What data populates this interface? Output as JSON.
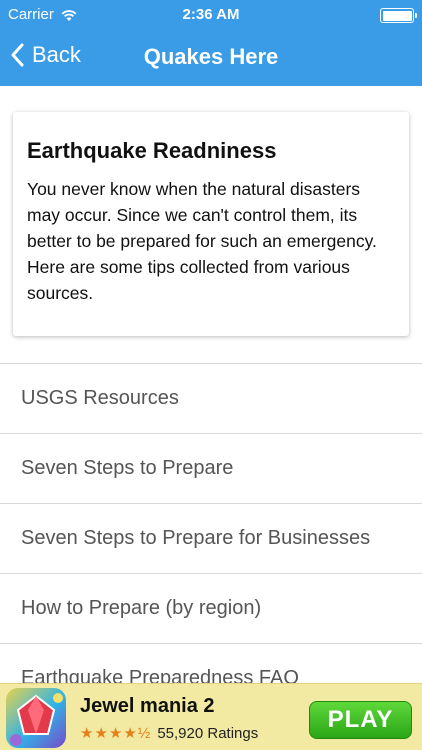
{
  "status_bar": {
    "carrier": "Carrier",
    "time": "2:36 AM"
  },
  "nav": {
    "back_label": "Back",
    "title": "Quakes Here"
  },
  "card": {
    "title": "Earthquake Readniness",
    "text": "You never know when the natural disasters may occur. Since we can't control them, its better to be prepared for such an emergency. Here are some tips collected from various sources."
  },
  "list": {
    "items": [
      {
        "label": "USGS Resources"
      },
      {
        "label": "Seven Steps to Prepare"
      },
      {
        "label": "Seven Steps to Prepare for Businesses"
      },
      {
        "label": "How to Prepare (by region)"
      },
      {
        "label": "Earthquake Preparedness FAQ"
      }
    ]
  },
  "ad": {
    "title": "Jewel mania 2",
    "rating_count": "55,920 Ratings",
    "stars": 4.5,
    "button_label": "PLAY"
  },
  "colors": {
    "header": "#3a9ce6",
    "ad_background": "#f2eaa3",
    "play_button": "#3cbf22",
    "stars": "#e6811a"
  }
}
